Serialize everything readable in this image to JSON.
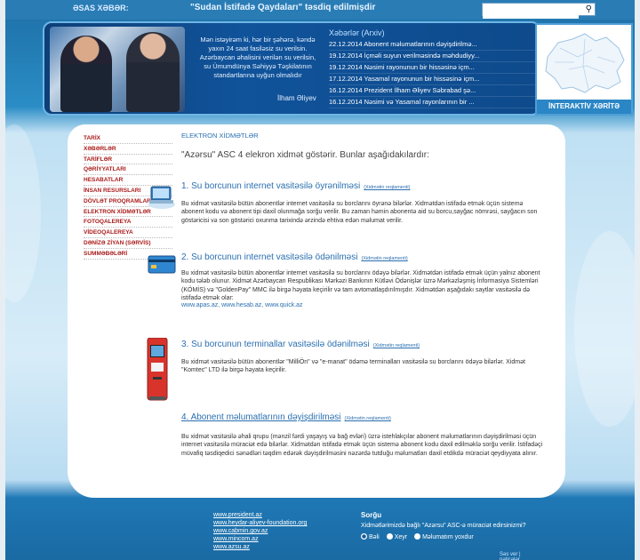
{
  "topbar": {
    "logo_text": "ƏSAS XƏBƏR:",
    "news_ticker": "\"Sudan İstifadə Qaydaları\" təsdiq edilmişdir",
    "search_placeholder": ""
  },
  "header": {
    "quote": "Mən istəyirəm ki, hər bir şəhərə, kəndə yaxın 24 saat fasiləsiz su verilsin. Azərbaycan əhalisini verilən su verilsin, su Ümumdünya Səhiyyə Təşkilatının standartlarına uyğun olmalıdır",
    "quote_author": "İlham Əliyev",
    "news_title": "Xəbərlər (Arxiv)",
    "news": [
      "22.12.2014 Abonent məlumatlarının dəyişdirilmə...",
      "19.12.2014 İçməli suyun verilməsində məhdudiyy...",
      "19.12.2014 Nəsimi rayonunun bir hissəsinə içm...",
      "17.12.2014 Yasamal rayonunun bir hissəsinə içm...",
      "16.12.2014 Prezident İlham Əliyev Səbrabad şə...",
      "16.12.2014 Nəsimi və Yasamal rayonlarının bir ..."
    ],
    "map_label": "İNTERAKTİV XƏRİTƏ"
  },
  "sidebar": {
    "items": [
      "TARİX",
      "XƏBƏRLƏR",
      "TARİFLƏR",
      "QƏRİYYATLARI",
      "HESABATLAR",
      "İNSAN RESURSLARI",
      "DÖVLƏT PROQRAMLARI",
      "ELEKTRON XİDMƏTLƏR",
      "FOTOQALEREYA",
      "VİDEOQALEREYA",
      "DƏNİZƏ ZİYAN (SƏRVİS)",
      "SUMMƏBƏLƏRİ"
    ]
  },
  "main": {
    "breadcrumb": "ELEKTRON XİDMƏTLƏR",
    "intro": "\"Azərsu\" ASC 4 elekron xidmət göstərir. Bunlar aşağıdakılardır:",
    "services": [
      {
        "title": "1. Su borcunun internet vasitəsilə öyrənilməsi",
        "link": "(Xidmətin reqlamenti)",
        "text": "Bu xidmət vasitəsilə bütün abonentlər internet vasitəsilə su borclarını öyrənə bilərlər. Xidmətdən istifadə etmək üçün sistemə abonent kodu və abonent tipi daxil olunmağa sorğu verilir. Bu zaman həmin abonentə aid su borcu,sayğac nömrəsi, sayğacın son göstəricisi və son göstərici oxunma tarixində ərzində ehtiva edən məlumat verilir.",
        "sites": ""
      },
      {
        "title": "2. Su borcunun internet vasitəsilə ödənilməsi",
        "link": "(Xidmətin reqlamenti)",
        "text": "Bu xidmət vasitəsilə bütün abonentlər internet vasitəsilə su borclarını ödəyə bilərlər. Xidmətdən istifadə etmək üçün yalnız abonent kodu tələb olunur. Xidmət Azərbaycan Respublikası Mərkəzi Bankının Kütləvi Ödənişlər üzrə Mərkəzləşmiş İnformasiya Sistemləri (KÖMİS) və \"GoldenPay\" MMC ilə birgə həyata keçirilir və tam avtomatlaşdırılmışdır. Xidmətdən aşağıdakı saytlar vasitəsilə də istifadə etmək olar:",
        "sites": "www.apas.az, www.hesab.az, www.quick.az"
      },
      {
        "title": "3. Su borcunun terminallar vasitəsilə ödənilməsi",
        "link": "(Xidmətin reqlamenti)",
        "text": "Bu xidmət vasitəsilə bütün abonentlər \"MilliÖn\" və \"e-manat\" ödəmə terminalları vasitəsilə su borclarını ödəyə bilərlər. Xidmət \"Komtec\" LTD ilə birgə həyata keçirilir.",
        "sites": ""
      },
      {
        "title": "4. Abonent məlumatlarının dəyişdirilməsi",
        "link": "(Xidmətin reqlamenti)",
        "text": "Bu xidmət vasitəsilə əhali qrupu (mənzil fərdi yaşayış və bağ evləri) üzrə istehlakçılar abonent məlumatlarının dəyişdirilməsi üçün internet vasitəsilə müraciət edə bilərlər. Xidmətdən istifadə etmək üçün sistemə abonent kodu daxil edilməklə sorğu verilir. İstifadəçi müvafiq təsdiqedici sənədləri təqdim edərək dəyişdirilməsini nəzərdə tutduğu məlumatları daxil etdikdə müraciət qeydiyyata alınır.",
        "sites": ""
      }
    ]
  },
  "footer": {
    "links": [
      "www.president.az",
      "www.heydar-aliyev-foundation.org",
      "www.cabmin.gov.az",
      "www.mincom.az",
      "www.azsu.az"
    ],
    "poll_title": "Sorğu",
    "poll_question": "Xidmətlərimizdə bağlı \"Azərsu\" ASC-ə müraciət edirsinizmi?",
    "poll_options": [
      "Bəli",
      "Xeyr",
      "Məlumatım yoxdur"
    ],
    "poll_results": "Səs ver | nəticələr"
  }
}
